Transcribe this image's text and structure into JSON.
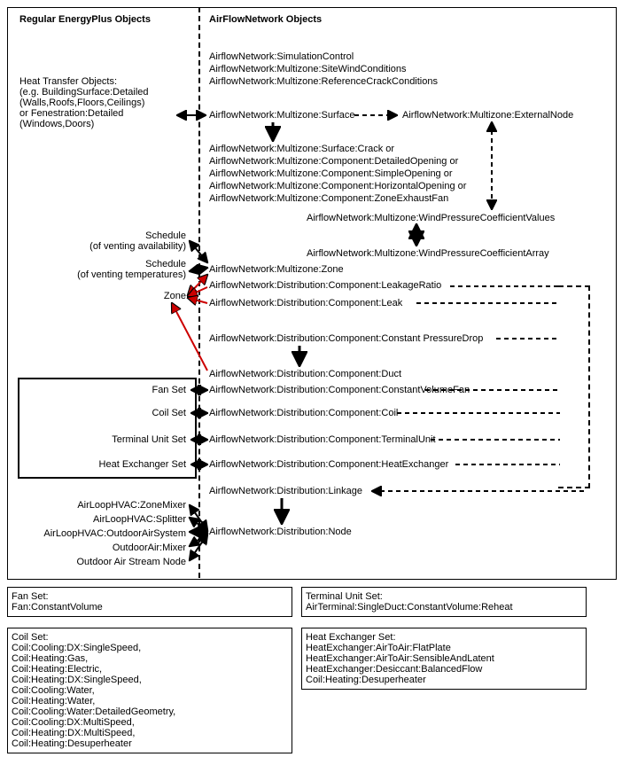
{
  "headers": {
    "left": "Regular EnergyPlus Objects",
    "right": "AirFlowNetwork Objects"
  },
  "left": {
    "heat_transfer": "Heat Transfer Objects:\n(e.g. BuildingSurface:Detailed\n(Walls,Roofs,Floors,Ceilings)\nor Fenestration:Detailed\n(Windows,Doors)",
    "schedule_vent": "Schedule\n(of venting availability)",
    "schedule_temp": "Schedule\n(of venting temperatures)",
    "zone": "Zone",
    "fan_set": "Fan Set",
    "coil_set": "Coil Set",
    "tu_set": "Terminal Unit Set",
    "hx_set": "Heat Exchanger Set",
    "zone_mixer": "AirLoopHVAC:ZoneMixer",
    "splitter": "AirLoopHVAC:Splitter",
    "oa_sys": "AirLoopHVAC:OutdoorAirSystem",
    "oa_mixer": "OutdoorAir:Mixer",
    "oa_stream": "Outdoor Air Stream Node"
  },
  "right": {
    "sim_ctrl": "AirflowNetwork:SimulationControl",
    "site_wind": "AirflowNetwork:Multizone:SiteWindConditions",
    "ref_crack": "AirflowNetwork:Multizone:ReferenceCrackConditions",
    "surface": "AirflowNetwork:Multizone:Surface",
    "ext_node": "AirflowNetwork:Multizone:ExternalNode",
    "crack": "AirflowNetwork:Multizone:Surface:Crack or",
    "det_open": "AirflowNetwork:Multizone:Component:DetailedOpening or",
    "simple_open": "AirflowNetwork:Multizone:Component:SimpleOpening or",
    "horiz_open": "AirflowNetwork:Multizone:Component:HorizontalOpening or",
    "exhaust_fan": "AirflowNetwork:Multizone:Component:ZoneExhaustFan",
    "wpcv": "AirflowNetwork:Multizone:WindPressureCoefficientValues",
    "wpca": "AirflowNetwork:Multizone:WindPressureCoefficientArray",
    "zone": "AirflowNetwork:Multizone:Zone",
    "leakage_ratio": "AirflowNetwork:Distribution:Component:LeakageRatio",
    "leak": "AirflowNetwork:Distribution:Component:Leak",
    "cpd": "AirflowNetwork:Distribution:Component:Constant PressureDrop",
    "duct": "AirflowNetwork:Distribution:Component:Duct",
    "cvfan": "AirflowNetwork:Distribution:Component:ConstantVolumeFan",
    "coil": "AirflowNetwork:Distribution:Component:Coil",
    "tu": "AirflowNetwork:Distribution:Component:TerminalUnit",
    "hx": "AirflowNetwork:Distribution:Component:HeatExchanger",
    "linkage": "AirflowNetwork:Distribution:Linkage",
    "node": "AirflowNetwork:Distribution:Node"
  },
  "legend": {
    "fan_set": "Fan Set:\nFan:ConstantVolume",
    "tu_set": "Terminal Unit Set:\nAirTerminal:SingleDuct:ConstantVolume:Reheat",
    "coil_set": "Coil Set:\nCoil:Cooling:DX:SingleSpeed,\nCoil:Heating:Gas,\nCoil:Heating:Electric,\nCoil:Heating:DX:SingleSpeed,\nCoil:Cooling:Water,\nCoil:Heating:Water,\nCoil:Cooling:Water:DetailedGeometry,\nCoil:Cooling:DX:MultiSpeed,\nCoil:Heating:DX:MultiSpeed,\nCoil:Heating:Desuperheater",
    "hx_set": "Heat Exchanger Set:\nHeatExchanger:AirToAir:FlatPlate\nHeatExchanger:AirToAir:SensibleAndLatent\nHeatExchanger:Desiccant:BalancedFlow\nCoil:Heating:Desuperheater"
  }
}
